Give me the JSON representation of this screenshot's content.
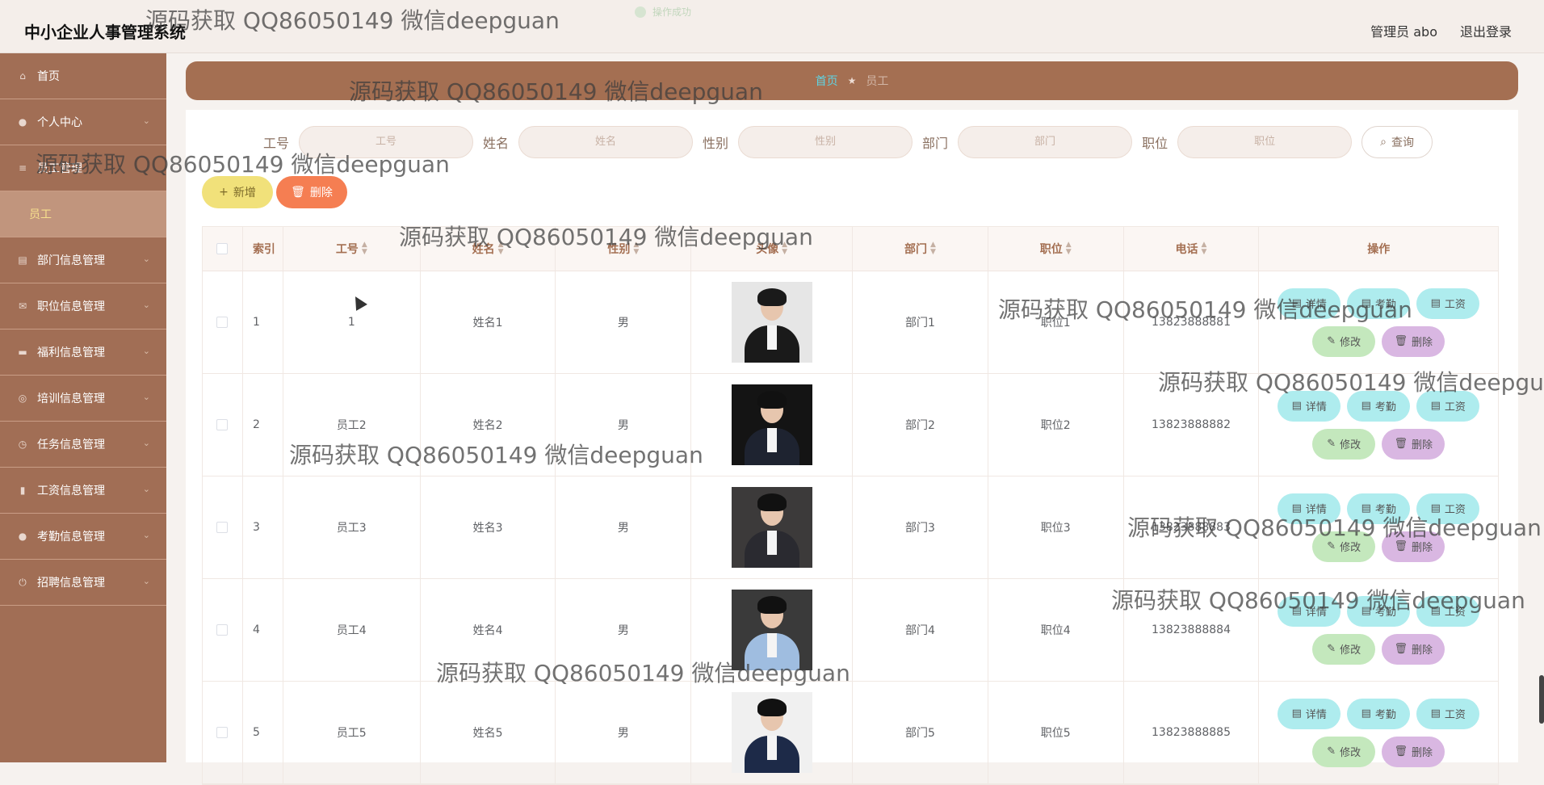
{
  "app": {
    "title": "中小企业人事管理系统",
    "admin": "管理员 abo",
    "logout": "退出登录",
    "toast": "操作成功"
  },
  "sidebar": {
    "items": [
      {
        "label": "首页",
        "icon": "home-icon"
      },
      {
        "label": "个人中心",
        "icon": "user-icon"
      },
      {
        "label": "员工管理",
        "icon": "menu-icon"
      },
      {
        "label": "员工",
        "sub": true
      },
      {
        "label": "部门信息管理",
        "icon": "clipboard-icon"
      },
      {
        "label": "职位信息管理",
        "icon": "mail-icon"
      },
      {
        "label": "福利信息管理",
        "icon": "printer-icon"
      },
      {
        "label": "培训信息管理",
        "icon": "compass-icon"
      },
      {
        "label": "任务信息管理",
        "icon": "clock-icon"
      },
      {
        "label": "工资信息管理",
        "icon": "chart-icon"
      },
      {
        "label": "考勤信息管理",
        "icon": "user-icon"
      },
      {
        "label": "招聘信息管理",
        "icon": "power-icon"
      }
    ]
  },
  "breadcrumb": {
    "home": "首页",
    "current": "员工"
  },
  "search": {
    "fields": [
      {
        "label": "工号",
        "placeholder": "工号"
      },
      {
        "label": "姓名",
        "placeholder": "姓名"
      },
      {
        "label": "性别",
        "placeholder": "性别"
      },
      {
        "label": "部门",
        "placeholder": "部门"
      },
      {
        "label": "职位",
        "placeholder": "职位"
      }
    ],
    "button": "查询"
  },
  "actions": {
    "add": "新增",
    "delete": "删除"
  },
  "table": {
    "headers": [
      "索引",
      "工号",
      "姓名",
      "性别",
      "头像",
      "部门",
      "职位",
      "电话",
      "操作"
    ],
    "rows": [
      {
        "index": "1",
        "id": "1",
        "name": "姓名1",
        "gender": "男",
        "dept": "部门1",
        "pos": "职位1",
        "phone": "13823888881"
      },
      {
        "index": "2",
        "id": "员工2",
        "name": "姓名2",
        "gender": "男",
        "dept": "部门2",
        "pos": "职位2",
        "phone": "13823888882"
      },
      {
        "index": "3",
        "id": "员工3",
        "name": "姓名3",
        "gender": "男",
        "dept": "部门3",
        "pos": "职位3",
        "phone": "13823888883"
      },
      {
        "index": "4",
        "id": "员工4",
        "name": "姓名4",
        "gender": "男",
        "dept": "部门4",
        "pos": "职位4",
        "phone": "13823888884"
      },
      {
        "index": "5",
        "id": "员工5",
        "name": "姓名5",
        "gender": "男",
        "dept": "部门5",
        "pos": "职位5",
        "phone": "13823888885"
      }
    ],
    "ops": {
      "detail": "详情",
      "attendance": "考勤",
      "salary": "工资",
      "edit": "修改",
      "delete": "删除"
    }
  },
  "watermark": "源码获取 QQ86050149 微信deepguan",
  "colors": {
    "sidebar": "#a16e55",
    "crumb": "#a46f52",
    "accent": "#5fd3e2"
  }
}
